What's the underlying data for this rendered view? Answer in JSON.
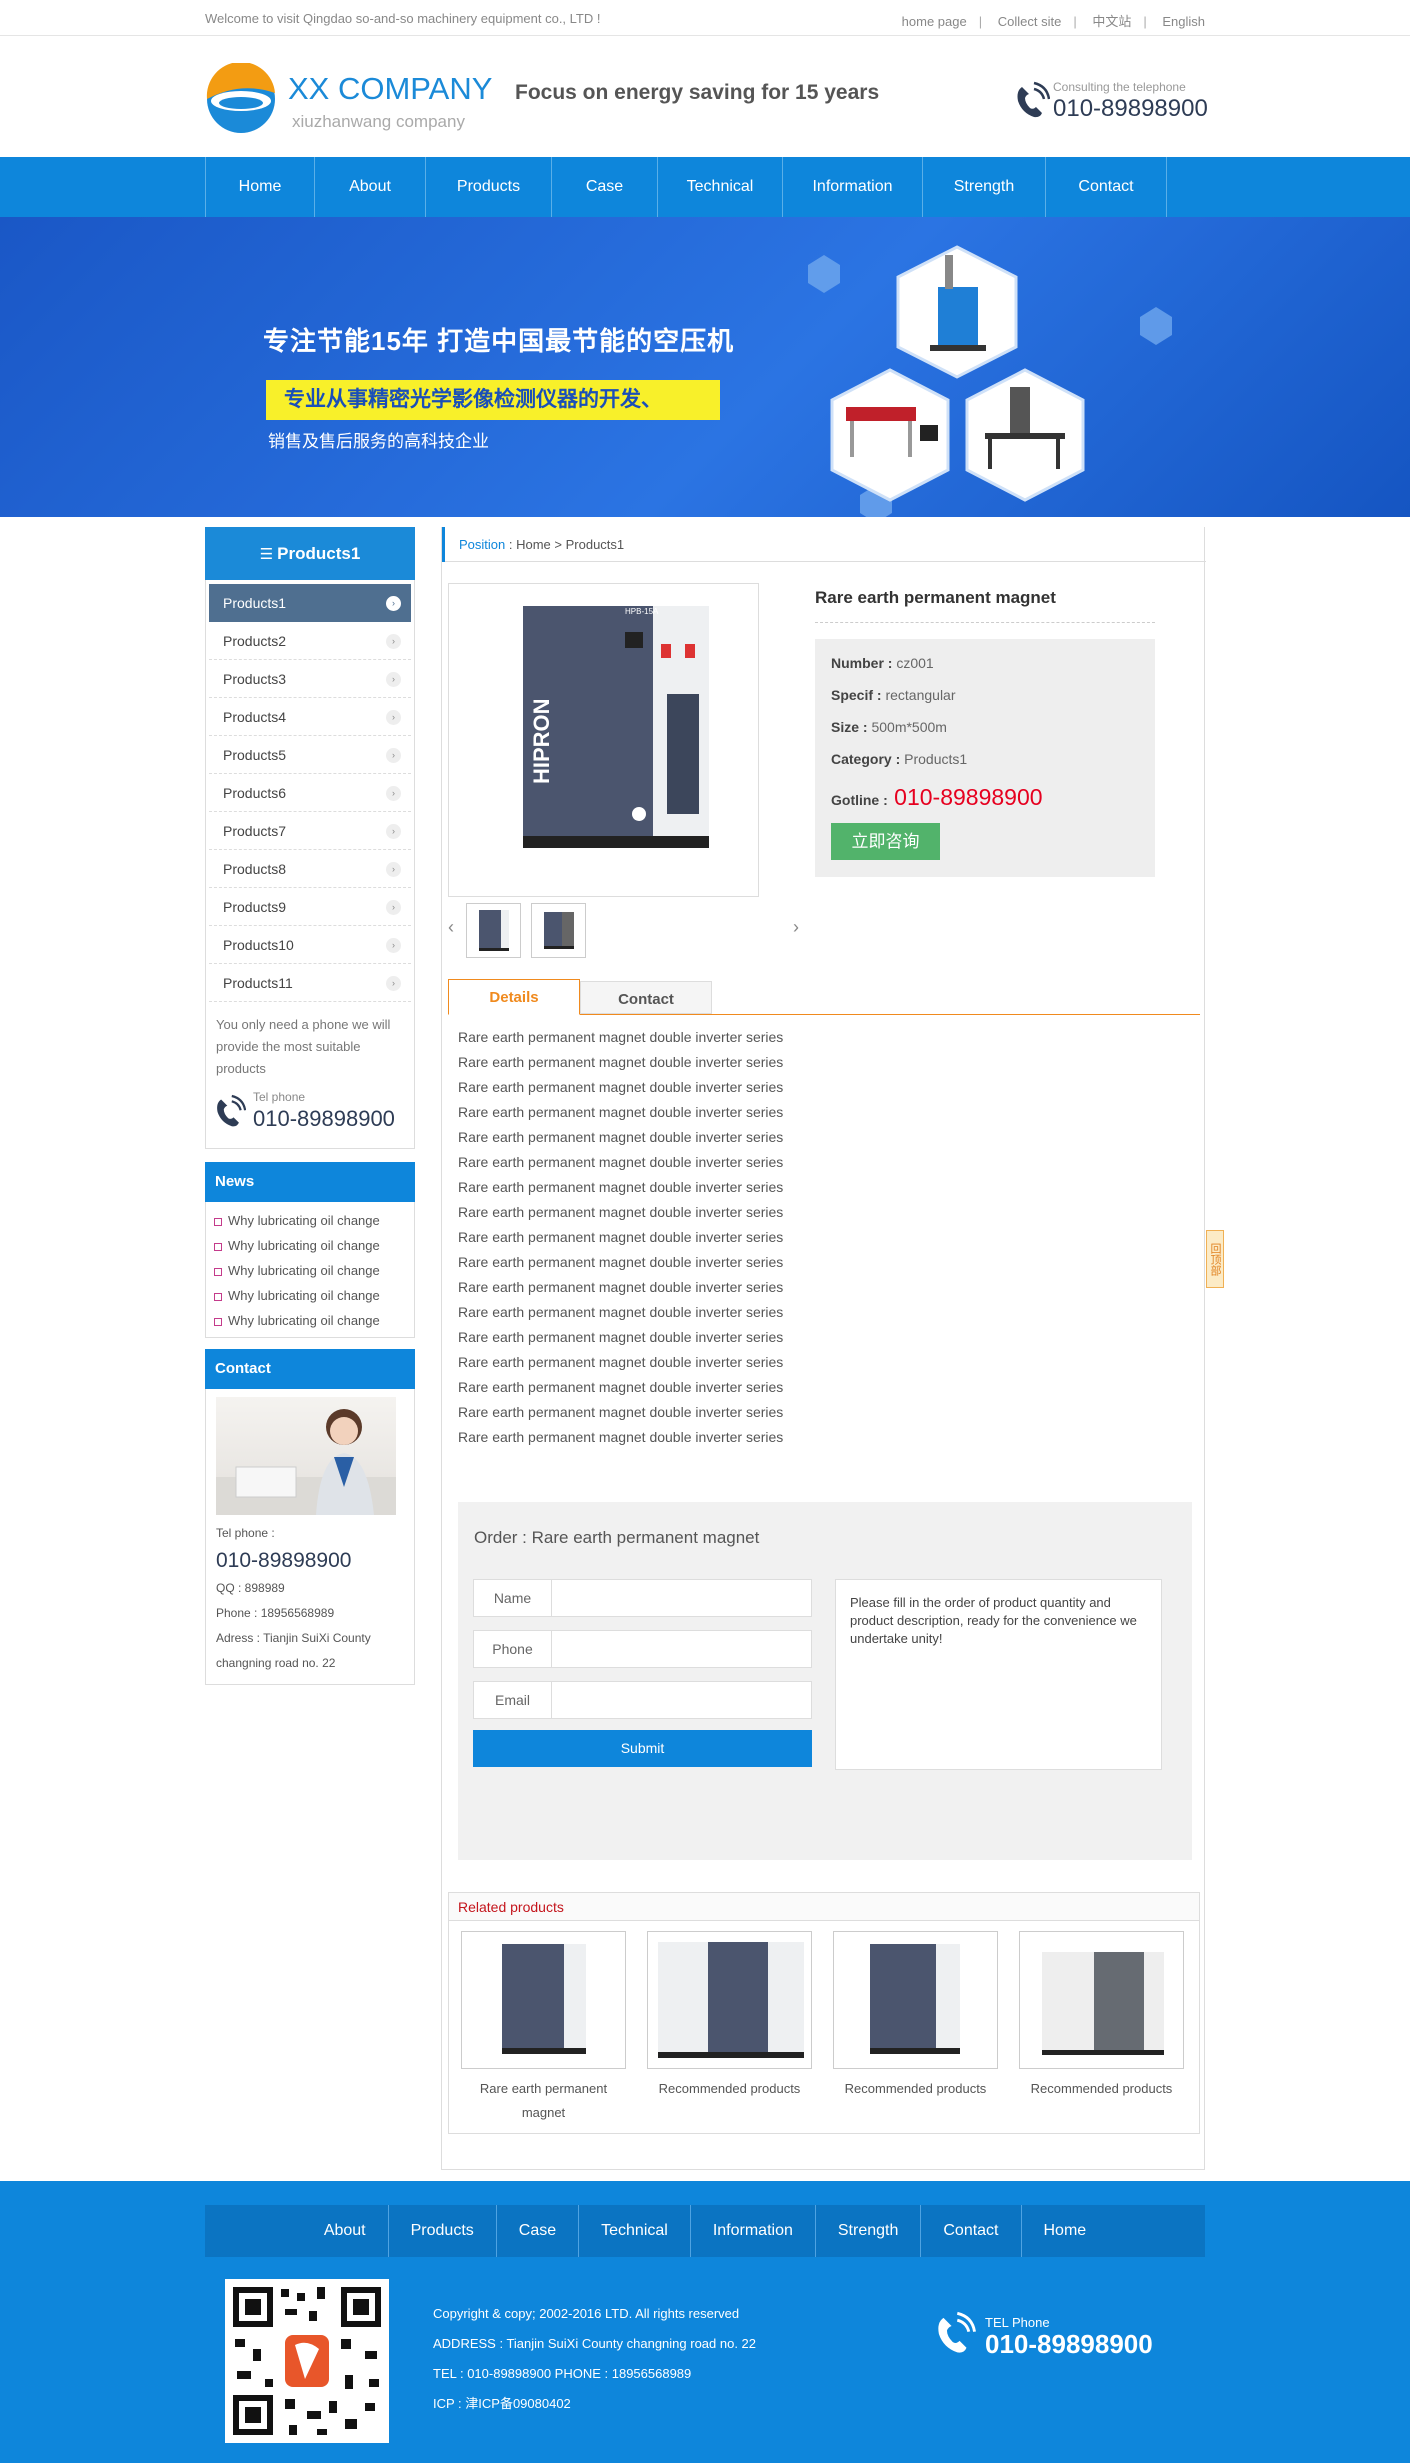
{
  "topbar": {
    "welcome": "Welcome to visit Qingdao so-and-so machinery equipment co., LTD !",
    "links": [
      "home page",
      "Collect site",
      "中文站",
      "English"
    ]
  },
  "header": {
    "logo_name": "XX COMPANY",
    "logo_sub": "xiuzhanwang company",
    "slogan": "Focus on energy saving for 15 years",
    "tel_label": "Consulting the telephone",
    "tel_number": "010-89898900"
  },
  "nav": [
    "Home",
    "About",
    "Products",
    "Case",
    "Technical",
    "Information",
    "Strength",
    "Contact"
  ],
  "banner": {
    "line1": "专注节能15年  打造中国最节能的空压机",
    "line2": "专业从事精密光学影像检测仪器的开发、",
    "line3": "销售及售后服务的高科技企业"
  },
  "sidebar": {
    "title": "Products1",
    "items": [
      "Products1",
      "Products2",
      "Products3",
      "Products4",
      "Products5",
      "Products6",
      "Products7",
      "Products8",
      "Products9",
      "Products10",
      "Products11"
    ],
    "note": "You only need a phone we will provide the most suitable products",
    "tel_label": "Tel phone",
    "tel_number": "010-89898900"
  },
  "news": {
    "title": "News",
    "items": [
      "Why lubricating oil change",
      "Why lubricating oil change",
      "Why lubricating oil change",
      "Why lubricating oil change",
      "Why lubricating oil change"
    ]
  },
  "contact": {
    "title": "Contact",
    "tel_label": "Tel phone :",
    "tel_number": "010-89898900",
    "qq": "QQ : 898989",
    "phone": "Phone : 18956568989",
    "address1": "Adress : Tianjin SuiXi County",
    "address2": "changning road no. 22"
  },
  "breadcrumb": {
    "position": "Position",
    "sep": " : ",
    "home": "Home",
    "arrow": " > ",
    "current": "Products1"
  },
  "product": {
    "name": "Rare earth permanent magnet",
    "number_label": "Number :",
    "number": " cz001",
    "specif_label": "Specif :",
    "specif": " rectangular",
    "size_label": "Size :",
    "size": " 500m*500m",
    "category_label": "Category :",
    "category": " Products1",
    "gotline_label": "Gotline :",
    "gotline": " 010-89898900",
    "consult_button": "立即咨询",
    "image_brand": "HIPRON",
    "image_model": "HPB-15A"
  },
  "tabs": [
    "Details",
    "Contact"
  ],
  "details_line": "Rare earth permanent magnet double inverter series",
  "details_count": 17,
  "order": {
    "title": "Order : Rare earth permanent magnet",
    "fields": [
      "Name",
      "Phone",
      "Email"
    ],
    "submit": "Submit",
    "message": "Please fill in the order of product quantity and product description, ready for the convenience we undertake unity!"
  },
  "related": {
    "title": "Related products",
    "items": [
      "Rare earth permanent magnet",
      "Recommended products",
      "Recommended products",
      "Recommended products"
    ]
  },
  "float_tag": "回顶部",
  "footer": {
    "nav": [
      "About",
      "Products",
      "Case",
      "Technical",
      "Information",
      "Strength",
      "Contact",
      "Home"
    ],
    "copyright": "Copyright & copy; 2002-2016 LTD. All rights reserved",
    "address": "ADDRESS : Tianjin SuiXi County changning road no. 22",
    "tel": "TEL : 010-89898900 PHONE : 18956568989",
    "icp": "ICP : 津ICP备09080402",
    "tel_label": "TEL Phone",
    "tel_number": "010-89898900"
  },
  "colors": {
    "brand_blue": "#0e86db",
    "banner_yellow": "#f8f02a",
    "accent_orange": "#f08a1e",
    "gotline_red": "#e6001f",
    "consult_green": "#52b36b"
  }
}
